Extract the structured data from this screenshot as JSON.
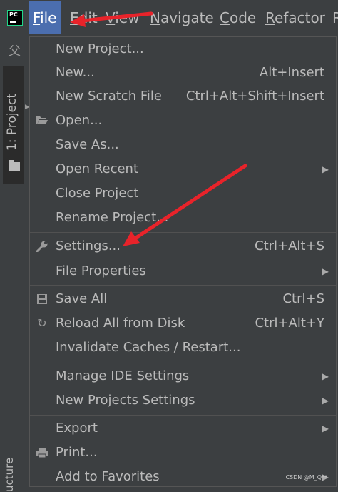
{
  "app": {
    "logo_text": "PC"
  },
  "menubar": {
    "items": [
      {
        "label": "File",
        "mnemonic": "F",
        "rest": "ile"
      },
      {
        "label": "Edit",
        "mnemonic": "E",
        "rest": "dit"
      },
      {
        "label": "View",
        "mnemonic": "V",
        "rest": "iew"
      },
      {
        "label": "Navigate",
        "mnemonic": "N",
        "rest": "avigate"
      },
      {
        "label": "Code",
        "mnemonic": "C",
        "rest": "ode"
      },
      {
        "label": "Refactor",
        "mnemonic": "R",
        "rest": "efactor"
      },
      {
        "label": "R",
        "mnemonic": "",
        "rest": "R"
      }
    ]
  },
  "toolstrip": {
    "project_tab": "1: Project",
    "structure_tab": "ucture"
  },
  "file_menu": {
    "items": [
      {
        "id": "new-project",
        "label": "New Project...",
        "shortcut": "",
        "icon": ""
      },
      {
        "id": "new",
        "label": "New...",
        "shortcut": "Alt+Insert",
        "icon": ""
      },
      {
        "id": "new-scratch",
        "label": "New Scratch File",
        "shortcut": "Ctrl+Alt+Shift+Insert",
        "icon": ""
      },
      {
        "id": "open",
        "label": "Open...",
        "shortcut": "",
        "icon": "folder-open-icon"
      },
      {
        "id": "save-as",
        "label": "Save As...",
        "shortcut": "",
        "icon": ""
      },
      {
        "id": "open-recent",
        "label": "Open Recent",
        "shortcut": "",
        "icon": "",
        "submenu": true
      },
      {
        "id": "close-project",
        "label": "Close Project",
        "shortcut": "",
        "icon": ""
      },
      {
        "id": "rename-project",
        "label": "Rename Project...",
        "shortcut": "",
        "icon": ""
      },
      {
        "id": "settings",
        "label": "Settings...",
        "shortcut": "Ctrl+Alt+S",
        "icon": "wrench-icon"
      },
      {
        "id": "file-properties",
        "label": "File Properties",
        "shortcut": "",
        "icon": "",
        "submenu": true
      },
      {
        "id": "save-all",
        "label": "Save All",
        "shortcut": "Ctrl+S",
        "icon": "floppy-disk-icon"
      },
      {
        "id": "reload-all",
        "label": "Reload All from Disk",
        "shortcut": "Ctrl+Alt+Y",
        "icon": "reload-icon"
      },
      {
        "id": "invalidate-caches",
        "label": "Invalidate Caches / Restart...",
        "shortcut": "",
        "icon": ""
      },
      {
        "id": "manage-ide-settings",
        "label": "Manage IDE Settings",
        "shortcut": "",
        "icon": "",
        "submenu": true
      },
      {
        "id": "new-projects-settings",
        "label": "New Projects Settings",
        "shortcut": "",
        "icon": "",
        "submenu": true
      },
      {
        "id": "export",
        "label": "Export",
        "shortcut": "",
        "icon": "",
        "submenu": true
      },
      {
        "id": "print",
        "label": "Print...",
        "shortcut": "",
        "icon": "printer-icon"
      },
      {
        "id": "add-to-favorites",
        "label": "Add to Favorites",
        "shortcut": "",
        "icon": "",
        "submenu": true
      }
    ]
  },
  "watermark": "CSDN @M_Q**",
  "colors": {
    "menu_bg": "#3c3f41",
    "selected_menu": "#4b6eaf",
    "text": "#bbbbbb",
    "annotation_arrow": "#e8232a"
  }
}
